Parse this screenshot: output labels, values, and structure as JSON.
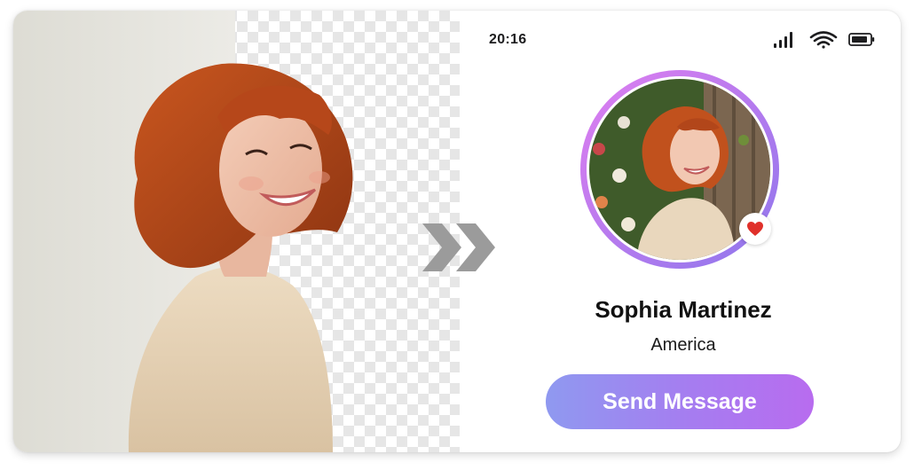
{
  "status_bar": {
    "time": "20:16",
    "icons": [
      "cellular-signal-icon",
      "wifi-icon",
      "battery-icon"
    ]
  },
  "comparison": {
    "left_region": "original-photo-background",
    "right_region": "transparent-checkerboard-background",
    "arrow_icon": "double-chevron-right-icon"
  },
  "profile": {
    "name": "Sophia Martinez",
    "location": "America",
    "badge_icon": "heart-icon",
    "send_label": "Send Message"
  },
  "colors": {
    "accent_start": "#8f99f0",
    "accent_end": "#b86cef",
    "heart": "#e0302a",
    "arrow": "#9b9b9b"
  }
}
